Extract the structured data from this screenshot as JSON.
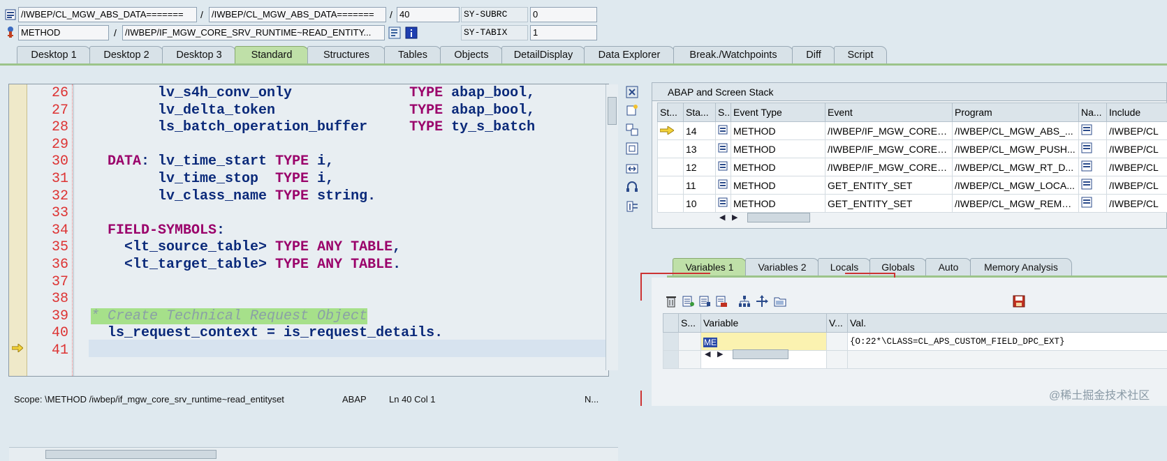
{
  "header": {
    "program_field": "/IWBEP/CL_MGW_ABS_DATA=======",
    "include_field": "/IWBEP/CL_MGW_ABS_DATA=======",
    "line_field": "40",
    "sy_subrc_label": "SY-SUBRC",
    "sy_subrc_value": "0",
    "event_type_field": "METHOD",
    "event_field": "/IWBEP/IF_MGW_CORE_SRV_RUNTIME~READ_ENTITY...",
    "sy_tabix_label": "SY-TABIX",
    "sy_tabix_value": "1",
    "separator": "/"
  },
  "tabs": [
    "Desktop 1",
    "Desktop 2",
    "Desktop 3",
    "Standard",
    "Structures",
    "Tables",
    "Objects",
    "DetailDisplay",
    "Data Explorer",
    "Break./Watchpoints",
    "Diff",
    "Script"
  ],
  "active_tab": "Standard",
  "editor": {
    "lines": [
      {
        "num": "26",
        "text": "        lv_s4h_conv_only              TYPE abap_bool,"
      },
      {
        "num": "27",
        "text": "        lv_delta_token                TYPE abap_bool,"
      },
      {
        "num": "28",
        "text": "        ls_batch_operation_buffer     TYPE ty_s_batch"
      },
      {
        "num": "29",
        "text": ""
      },
      {
        "num": "30",
        "text": "  DATA: lv_time_start TYPE i,"
      },
      {
        "num": "31",
        "text": "        lv_time_stop  TYPE i,"
      },
      {
        "num": "32",
        "text": "        lv_class_name TYPE string."
      },
      {
        "num": "33",
        "text": ""
      },
      {
        "num": "34",
        "text": "  FIELD-SYMBOLS:"
      },
      {
        "num": "35",
        "text": "    <lt_source_table> TYPE ANY TABLE,"
      },
      {
        "num": "36",
        "text": "    <lt_target_table> TYPE ANY TABLE."
      },
      {
        "num": "37",
        "text": ""
      },
      {
        "num": "38",
        "text": ""
      },
      {
        "num": "39",
        "text": "* Create Technical Request Object"
      },
      {
        "num": "40",
        "text": "  ls_request_context = is_request_details."
      },
      {
        "num": "41",
        "text": ""
      }
    ],
    "current_line": "40"
  },
  "status": {
    "scope": "Scope: \\METHOD /iwbep/if_mgw_core_srv_runtime~read_entityset",
    "language": "ABAP",
    "position": "Ln  40 Col   1",
    "mode": "N..."
  },
  "stack": {
    "title": "ABAP and Screen Stack",
    "columns": [
      "St...",
      "Sta...",
      "S..",
      "Event Type",
      "Event",
      "Program",
      "Na...",
      "Include"
    ],
    "rows": [
      {
        "sta": "14",
        "type": "METHOD",
        "event": "/IWBEP/IF_MGW_CORE_...",
        "program": "/IWBEP/CL_MGW_ABS_...",
        "include": "/IWBEP/CL"
      },
      {
        "sta": "13",
        "type": "METHOD",
        "event": "/IWBEP/IF_MGW_CORE_...",
        "program": "/IWBEP/CL_MGW_PUSH...",
        "include": "/IWBEP/CL"
      },
      {
        "sta": "12",
        "type": "METHOD",
        "event": "/IWBEP/IF_MGW_CORE_...",
        "program": "/IWBEP/CL_MGW_RT_D...",
        "include": "/IWBEP/CL"
      },
      {
        "sta": "11",
        "type": "METHOD",
        "event": "GET_ENTITY_SET",
        "program": "/IWBEP/CL_MGW_LOCA...",
        "include": "/IWBEP/CL"
      },
      {
        "sta": "10",
        "type": "METHOD",
        "event": "GET_ENTITY_SET",
        "program": "/IWBEP/CL_MGW_REMO...",
        "include": "/IWBEP/CL"
      }
    ]
  },
  "var_tabs": [
    "Variables 1",
    "Variables 2",
    "Locals",
    "Globals",
    "Auto",
    "Memory Analysis"
  ],
  "active_var_tab": "Variables 1",
  "variables": {
    "columns": [
      "S...",
      "Variable",
      "V...",
      "Val."
    ],
    "rows": [
      {
        "variable": "ME",
        "value": "{O:22*\\CLASS=CL_APS_CUSTOM_FIELD_DPC_EXT}"
      },
      {
        "variable": "",
        "value": ""
      }
    ]
  },
  "watermark": "@稀土掘金技术社区",
  "colors": {
    "keyword": "#9a006a",
    "identifier": "#0b2a7a",
    "line_number": "#d33",
    "active_tab": "#bfe0a8"
  }
}
